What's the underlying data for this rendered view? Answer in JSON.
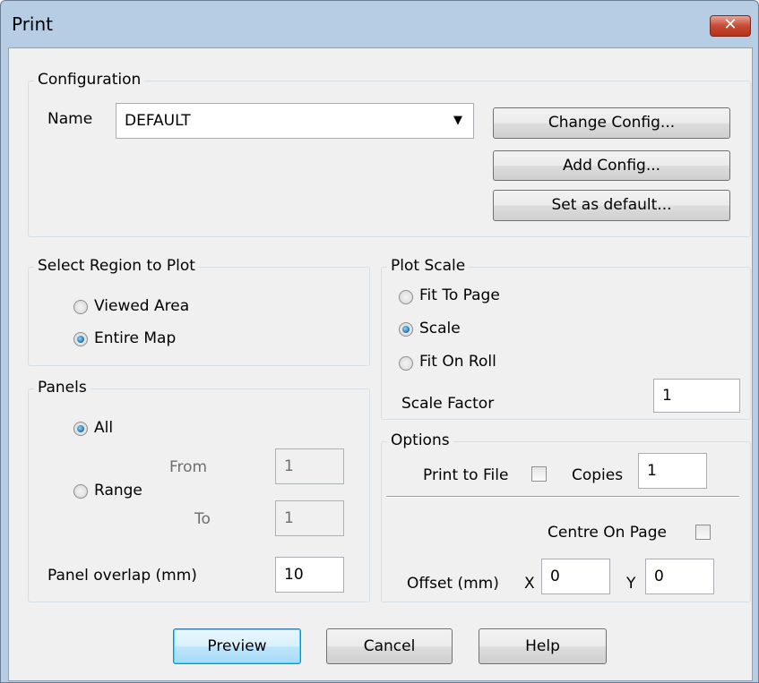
{
  "window": {
    "title": "Print",
    "close_glyph": "✕"
  },
  "configuration": {
    "legend": "Configuration",
    "name_label": "Name",
    "name_value": "DEFAULT",
    "dropdown_glyph": "▼",
    "buttons": {
      "change": "Change Config...",
      "add": "Add Config...",
      "set_default": "Set as default..."
    }
  },
  "region": {
    "legend": "Select Region to Plot",
    "options": [
      {
        "label": "Viewed Area",
        "checked": false
      },
      {
        "label": "Entire Map",
        "checked": true
      }
    ]
  },
  "plot_scale": {
    "legend": "Plot Scale",
    "options": [
      {
        "label": "Fit To Page",
        "checked": false
      },
      {
        "label": "Scale",
        "checked": true
      },
      {
        "label": "Fit On Roll",
        "checked": false
      }
    ],
    "scale_factor_label": "Scale Factor",
    "scale_factor_value": "1"
  },
  "panels": {
    "legend": "Panels",
    "all_label": "All",
    "range_label": "Range",
    "from_label": "From",
    "from_value": "1",
    "to_label": "To",
    "to_value": "1",
    "overlap_label": "Panel overlap (mm)",
    "overlap_value": "10"
  },
  "options": {
    "legend": "Options",
    "print_to_file_label": "Print to File",
    "print_to_file_checked": false,
    "copies_label": "Copies",
    "copies_value": "1",
    "centre_label": "Centre On Page",
    "centre_checked": false,
    "offset_label": "Offset (mm)",
    "x_label": "X",
    "x_value": "0",
    "y_label": "Y",
    "y_value": "0"
  },
  "footer": {
    "preview": "Preview",
    "cancel": "Cancel",
    "help": "Help"
  }
}
